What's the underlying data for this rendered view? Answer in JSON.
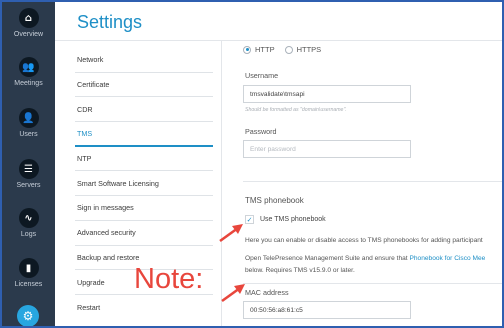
{
  "nav": {
    "items": [
      {
        "label": "Overview",
        "glyph": "⌂"
      },
      {
        "label": "Meetings",
        "glyph": "👥"
      },
      {
        "label": "Users",
        "glyph": "👤"
      },
      {
        "label": "Servers",
        "glyph": "☰"
      },
      {
        "label": "Logs",
        "glyph": "∿"
      },
      {
        "label": "Licenses",
        "glyph": "▮"
      }
    ],
    "settings_glyph": "⚙"
  },
  "header": {
    "title": "Settings"
  },
  "menu": {
    "items": [
      "Network",
      "Certificate",
      "CDR",
      "TMS",
      "NTP",
      "Smart Software Licensing",
      "Sign in messages",
      "Advanced security",
      "Backup and restore",
      "Upgrade",
      "Restart"
    ],
    "active": "TMS"
  },
  "form": {
    "protocol": {
      "http_label": "HTTP",
      "https_label": "HTTPS",
      "selected": "HTTP"
    },
    "username": {
      "label": "Username",
      "value": "tmsvalidate\\tmsapi",
      "hint": "Should be formatted as \"domain\\username\"."
    },
    "password": {
      "label": "Password",
      "placeholder": "Enter password"
    },
    "phonebook": {
      "title": "TMS phonebook",
      "checkbox_label": "Use TMS phonebook",
      "checked": true,
      "desc1": "Here you can enable or disable access to TMS phonebooks for adding participant",
      "desc2_prefix": "Open TelePresence Management Suite and ensure that ",
      "desc2_link": "Phonebook for Cisco Mee",
      "desc3": "below. Requires TMS v15.9.0 or later."
    },
    "mac": {
      "label": "MAC address",
      "value": "00:50:56:a8:61:c5"
    }
  },
  "annotation": {
    "text": "Note:",
    "color": "#e8463c"
  },
  "colors": {
    "accent": "#1e8fc6",
    "rail": "#2b3a4c",
    "frame": "#2f5fb0"
  }
}
